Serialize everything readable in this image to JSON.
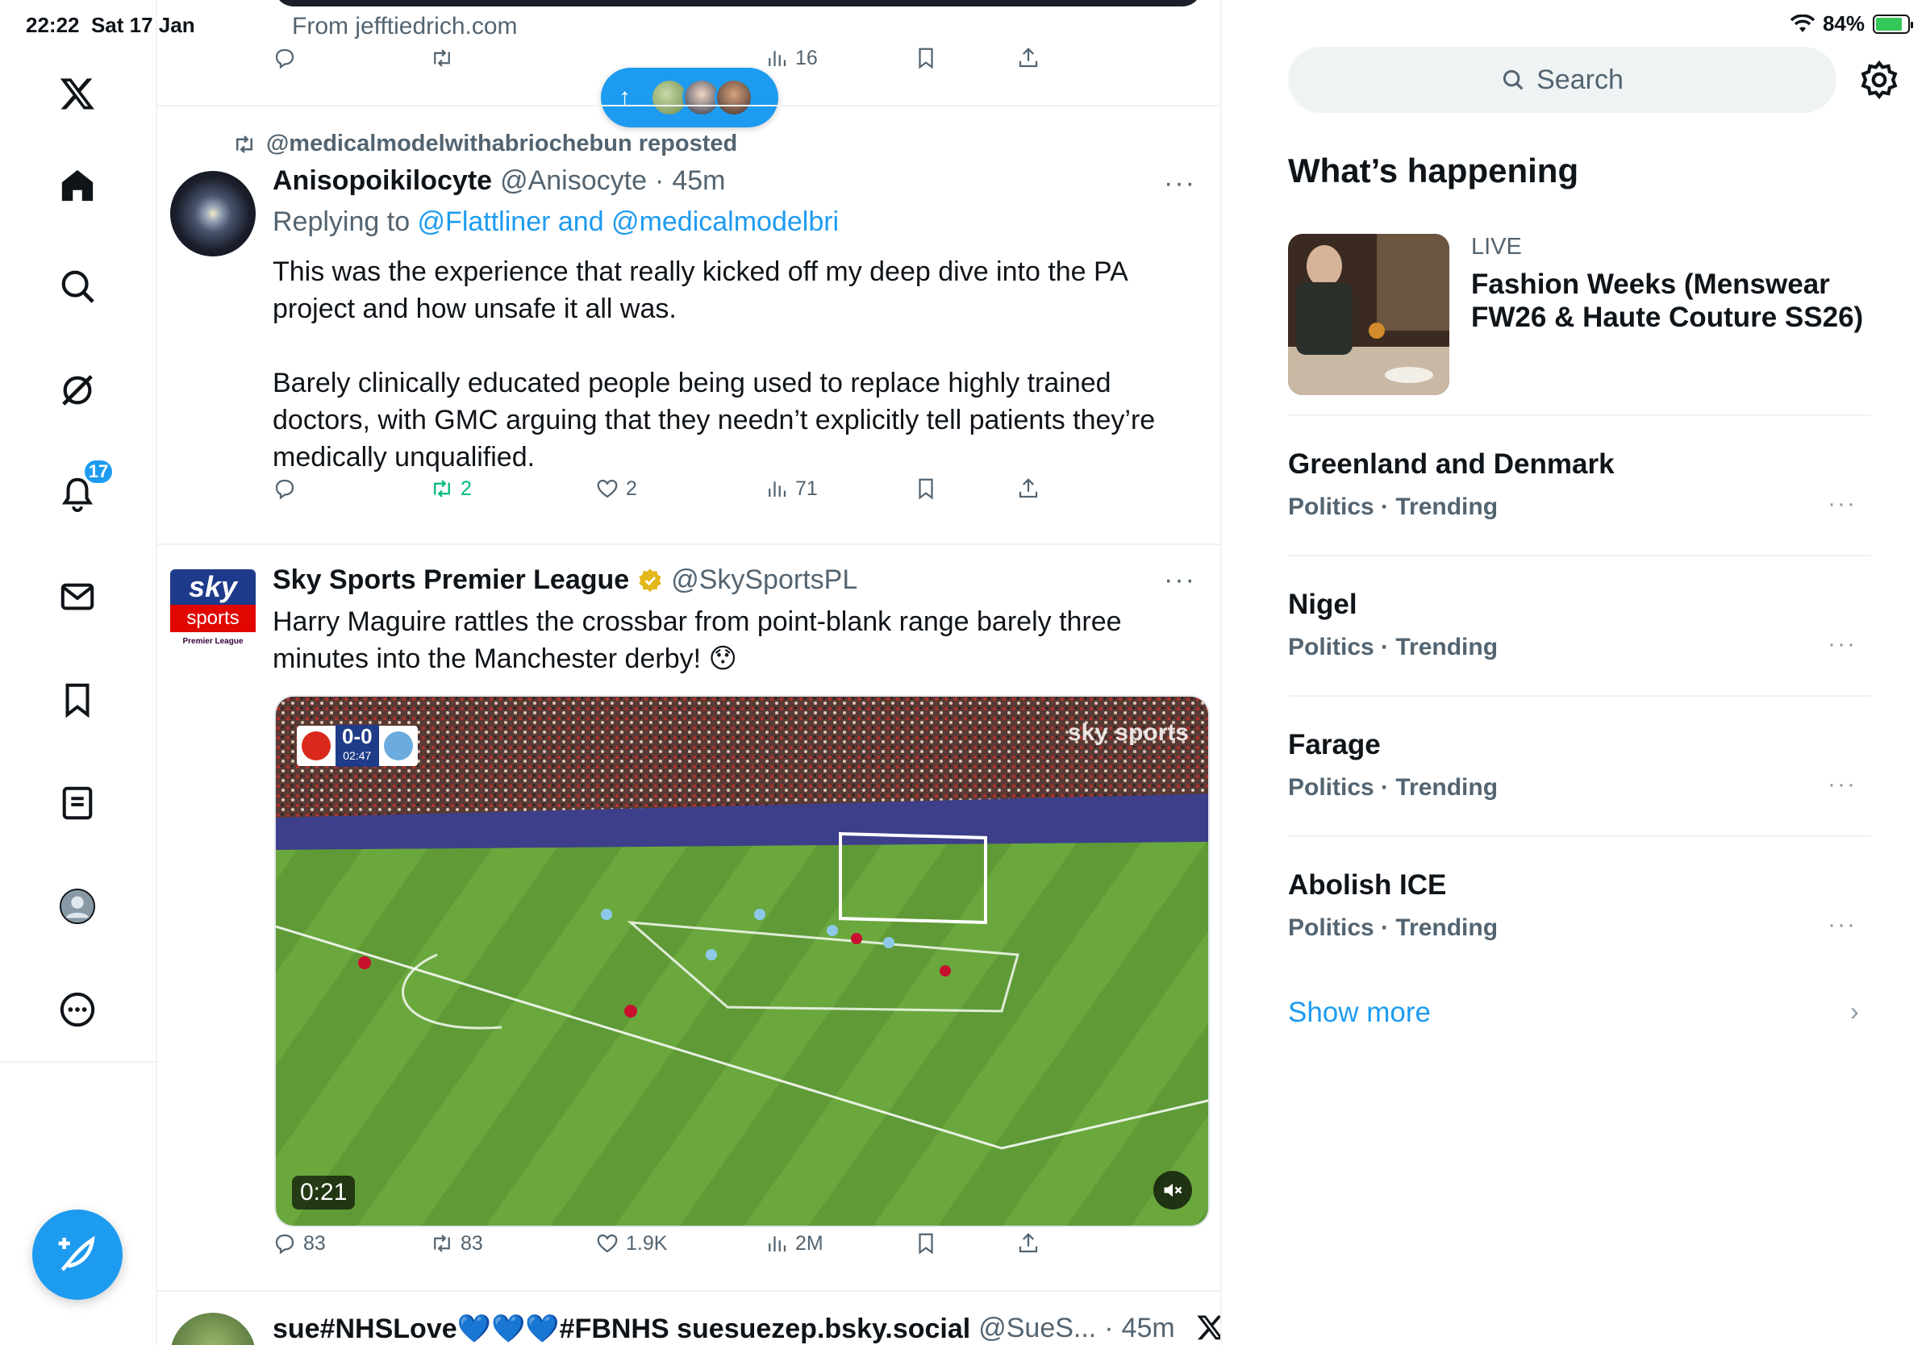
{
  "status_bar": {
    "time": "22:22",
    "date": "Sat 17 Jan",
    "battery": "84%",
    "battery_level": 0.84
  },
  "nav": {
    "notifications_badge": "17",
    "items": [
      "home",
      "search",
      "grok",
      "notifications",
      "messages",
      "bookmarks",
      "lists",
      "profile",
      "more"
    ]
  },
  "top_tweet": {
    "from": "From jefftiedrich.com",
    "views": "16"
  },
  "new_posts_pill": {
    "arrow": "↑"
  },
  "tweet1": {
    "repost_label": "@medicalmodelwithabriochebun reposted",
    "name": "Anisopoikilocyte",
    "handle": "@Anisocyte",
    "time": "45m",
    "replying_prefix": "Replying to ",
    "replying_to": "@Flattliner and @medicalmodelbri",
    "body": "This was the experience that really kicked off my deep dive into the PA project and how unsafe it all was.\n\nBarely clinically educated people being used to replace highly trained doctors, with GMC arguing that they needn’t explicitly tell patients they’re medically unqualified.",
    "reposts": "2",
    "likes": "2",
    "views": "71"
  },
  "tweet2": {
    "name": "Sky Sports Premier League",
    "handle": "@SkySportsPL",
    "body": "Harry Maguire rattles the crossbar from point-blank range barely three minutes into the Manchester derby! 😯",
    "video_duration": "0:21",
    "score": "0-0",
    "match_clock": "02:47",
    "watermark": "sky sports",
    "replies": "83",
    "reposts": "83",
    "likes": "1.9K",
    "views": "2M",
    "logo_top": "sky",
    "logo_bottom": "sports",
    "logo_sub": "Premier League"
  },
  "tweet3": {
    "name": "sue#NHSLove💙💙💙#FBNHS suesuezep.bsky.social",
    "handle": "@SueS...",
    "time": "45m"
  },
  "sidebar": {
    "search_placeholder": "Search",
    "section_title": "What’s happening",
    "live": {
      "label": "LIVE",
      "title": "Fashion Weeks (Menswear FW26 & Haute Couture SS26)"
    },
    "trends": [
      {
        "name": "Greenland and Denmark",
        "meta": "Politics · Trending"
      },
      {
        "name": "Nigel",
        "meta": "Politics · Trending"
      },
      {
        "name": "Farage",
        "meta": "Politics · Trending"
      },
      {
        "name": "Abolish ICE",
        "meta": "Politics · Trending"
      }
    ],
    "show_more": "Show more"
  },
  "colors": {
    "accent": "#1d9bf0",
    "repost_green": "#00ba7c",
    "text_secondary": "#536471"
  }
}
